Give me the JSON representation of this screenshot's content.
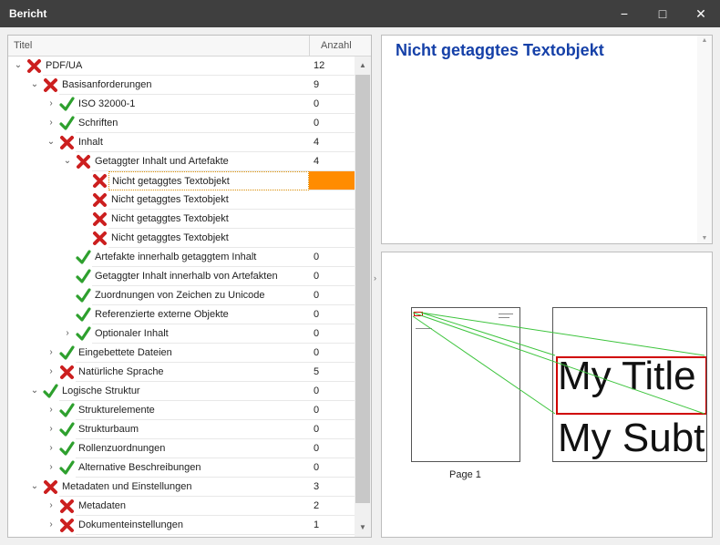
{
  "window": {
    "title": "Bericht",
    "minimize_glyph": "−",
    "maximize_glyph": "□",
    "close_glyph": "✕"
  },
  "tree": {
    "header": {
      "title": "Titel",
      "count": "Anzahl"
    },
    "rows": [
      {
        "label": "PDF/UA",
        "count": "12",
        "level": 0,
        "expander": "expanded",
        "status": "fail"
      },
      {
        "label": "Basisanforderungen",
        "count": "9",
        "level": 1,
        "expander": "expanded",
        "status": "fail"
      },
      {
        "label": "ISO 32000-1",
        "count": "0",
        "level": 2,
        "expander": "collapsed",
        "status": "pass"
      },
      {
        "label": "Schriften",
        "count": "0",
        "level": 2,
        "expander": "collapsed",
        "status": "pass"
      },
      {
        "label": "Inhalt",
        "count": "4",
        "level": 2,
        "expander": "expanded",
        "status": "fail"
      },
      {
        "label": "Getaggter Inhalt und Artefakte",
        "count": "4",
        "level": 3,
        "expander": "expanded",
        "status": "fail"
      },
      {
        "label": "Nicht getaggtes Textobjekt",
        "count": "",
        "level": 4,
        "expander": "none",
        "status": "fail",
        "selected": true
      },
      {
        "label": "Nicht getaggtes Textobjekt",
        "count": "",
        "level": 4,
        "expander": "none",
        "status": "fail"
      },
      {
        "label": "Nicht getaggtes Textobjekt",
        "count": "",
        "level": 4,
        "expander": "none",
        "status": "fail"
      },
      {
        "label": "Nicht getaggtes Textobjekt",
        "count": "",
        "level": 4,
        "expander": "none",
        "status": "fail"
      },
      {
        "label": "Artefakte innerhalb getaggtem Inhalt",
        "count": "0",
        "level": 3,
        "expander": "none",
        "status": "pass"
      },
      {
        "label": "Getaggter Inhalt innerhalb von Artefakten",
        "count": "0",
        "level": 3,
        "expander": "none",
        "status": "pass"
      },
      {
        "label": "Zuordnungen von Zeichen zu Unicode",
        "count": "0",
        "level": 3,
        "expander": "none",
        "status": "pass"
      },
      {
        "label": "Referenzierte externe Objekte",
        "count": "0",
        "level": 3,
        "expander": "none",
        "status": "pass"
      },
      {
        "label": "Optionaler Inhalt",
        "count": "0",
        "level": 3,
        "expander": "collapsed",
        "status": "pass"
      },
      {
        "label": "Eingebettete Dateien",
        "count": "0",
        "level": 2,
        "expander": "collapsed",
        "status": "pass"
      },
      {
        "label": "Natürliche Sprache",
        "count": "5",
        "level": 2,
        "expander": "collapsed",
        "status": "fail"
      },
      {
        "label": "Logische Struktur",
        "count": "0",
        "level": 1,
        "expander": "expanded",
        "status": "pass"
      },
      {
        "label": "Strukturelemente",
        "count": "0",
        "level": 2,
        "expander": "collapsed",
        "status": "pass"
      },
      {
        "label": "Strukturbaum",
        "count": "0",
        "level": 2,
        "expander": "collapsed",
        "status": "pass"
      },
      {
        "label": "Rollenzuordnungen",
        "count": "0",
        "level": 2,
        "expander": "collapsed",
        "status": "pass"
      },
      {
        "label": "Alternative Beschreibungen",
        "count": "0",
        "level": 2,
        "expander": "collapsed",
        "status": "pass"
      },
      {
        "label": "Metadaten und Einstellungen",
        "count": "3",
        "level": 1,
        "expander": "expanded",
        "status": "fail"
      },
      {
        "label": "Metadaten",
        "count": "2",
        "level": 2,
        "expander": "collapsed",
        "status": "fail"
      },
      {
        "label": "Dokumenteinstellungen",
        "count": "1",
        "level": 2,
        "expander": "collapsed",
        "status": "fail"
      }
    ]
  },
  "description": {
    "heading": "Nicht getaggtes Textobjekt"
  },
  "preview": {
    "page_label": "Page 1",
    "zoom_title": "My Title",
    "zoom_subtitle": "My Subt"
  },
  "colors": {
    "fail": "#cc1f1f",
    "pass": "#2ea02e",
    "heading": "#1540a8",
    "selection": "#ff8c00",
    "highlight_box": "#d00000",
    "connector": "#3cc43c"
  },
  "icons": {
    "fail": "red-x-icon",
    "pass": "green-check-icon"
  }
}
